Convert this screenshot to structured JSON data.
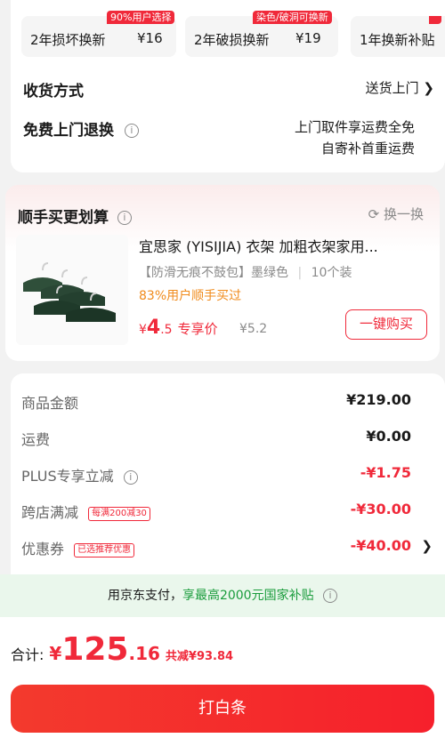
{
  "protection_options": [
    {
      "tag": "90%用户选择",
      "label": "2年损坏换新",
      "price": "¥16"
    },
    {
      "tag": "染色/破洞可换新",
      "label": "2年破损换新",
      "price": "¥19"
    },
    {
      "tag": "",
      "label": "1年换新补贴",
      "price": ""
    }
  ],
  "delivery": {
    "label": "收货方式",
    "value": "送货上门"
  },
  "free_return": {
    "label": "免费上门退换",
    "line1": "上门取件享运费全免",
    "line2": "自寄补首重运费"
  },
  "bundle": {
    "title": "顺手买更划算",
    "swap_label": "换一换",
    "product": {
      "name": "宜思家 (YISIJIA) 衣架 加粗衣架家用...",
      "spec_tag": "【防滑无痕不鼓包】墨绿色",
      "spec_qty": "10个装",
      "social": "83%用户顺手买过",
      "price_currency": "¥",
      "price_int": "4",
      "price_dec": ".5",
      "price_label": "专享价",
      "orig_price": "¥5.2",
      "buy_label": "一键购买"
    }
  },
  "summary": [
    {
      "label": "商品金额",
      "value": "¥219.00",
      "tag": "",
      "red": false,
      "info": false,
      "chevron": false
    },
    {
      "label": "运费",
      "value": "¥0.00",
      "tag": "",
      "red": false,
      "info": false,
      "chevron": false
    },
    {
      "label": "PLUS专享立减",
      "value": "-¥1.75",
      "tag": "",
      "red": true,
      "info": true,
      "chevron": false
    },
    {
      "label": "跨店满减",
      "value": "-¥30.00",
      "tag": "每满200减30",
      "red": true,
      "info": false,
      "chevron": false
    },
    {
      "label": "优惠券",
      "value": "-¥40.00",
      "tag": "已选推荐优惠",
      "red": true,
      "info": false,
      "chevron": true
    }
  ],
  "pay_banner": {
    "prefix": "用京东支付，",
    "highlight": "享最高2000元国家补贴"
  },
  "total": {
    "label": "合计:",
    "currency": "¥",
    "int": "125",
    "dec": ".16",
    "saved": "共减¥93.84"
  },
  "cta_label": "打白条",
  "colors": {
    "accent": "#f0293a",
    "orange": "#f08b1c",
    "green": "#1a9c3c",
    "banner_bg": "#eaf7ec"
  }
}
